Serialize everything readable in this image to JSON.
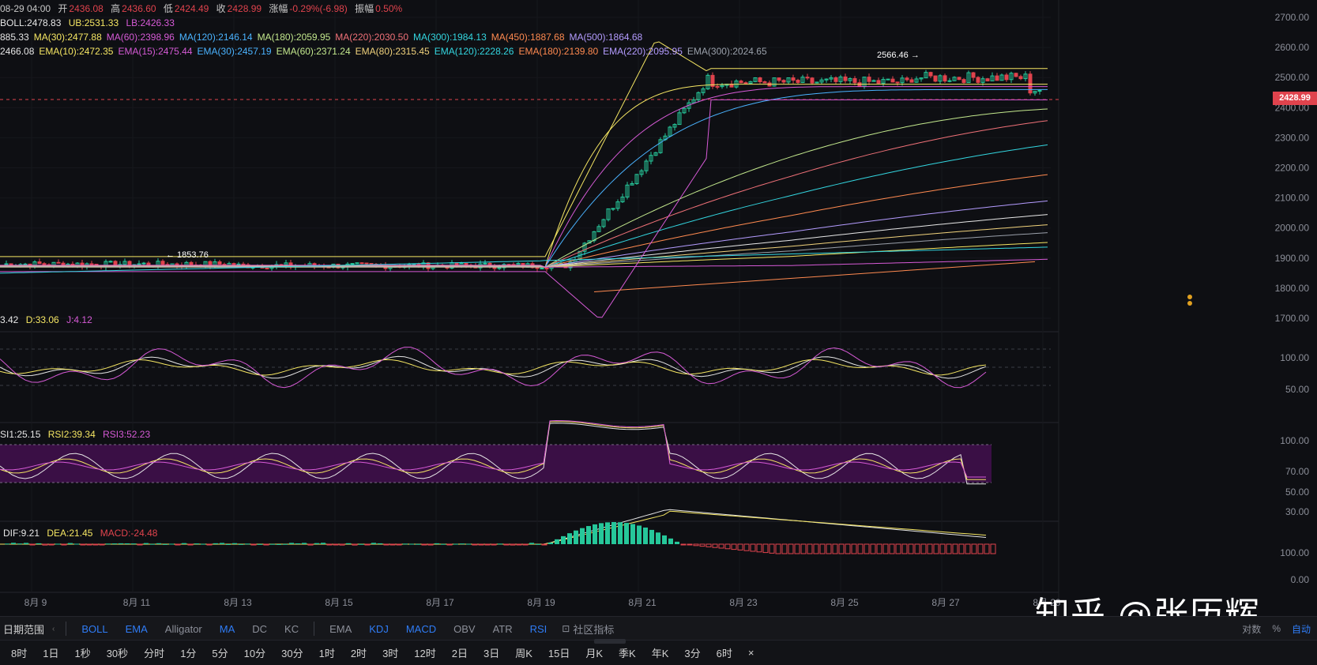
{
  "header": {
    "row1": {
      "time": "08-29 04:00",
      "open_label": "开",
      "open": "2436.08",
      "high_label": "高",
      "high": "2436.60",
      "low_label": "低",
      "low": "2424.49",
      "close_label": "收",
      "close": "2428.99",
      "chg_label": "涨幅",
      "chg": "-0.29%(-6.98)",
      "amp_label": "振幅",
      "amp": "0.50%"
    },
    "row2": {
      "boll": "BOLL:2478.83",
      "ub": "UB:2531.33",
      "lb": "LB:2426.33"
    },
    "row3": [
      "885.33",
      "MA(30):2477.88",
      "MA(60):2398.96",
      "MA(120):2146.14",
      "MA(180):2059.95",
      "MA(220):2030.50",
      "MA(300):1984.13",
      "MA(450):1887.68",
      "MA(500):1864.68"
    ],
    "row4": [
      "2466.08",
      "EMA(10):2472.35",
      "EMA(15):2475.44",
      "EMA(30):2457.19",
      "EMA(60):2371.24",
      "EMA(80):2315.45",
      "EMA(120):2228.26",
      "EMA(180):2139.80",
      "EMA(220):2095.95",
      "EMA(300):2024.65"
    ],
    "kdj": [
      "3.42",
      "D:33.06",
      "J:4.12"
    ],
    "rsi": [
      "SI1:25.15",
      "RSI2:39.34",
      "RSI3:52.23"
    ],
    "macd": [
      "DIF:9.21",
      "DEA:21.45",
      "MACD:-24.48"
    ]
  },
  "price_axis": [
    "2700.00",
    "2600.00",
    "2500.00",
    "2400.00",
    "2300.00",
    "2200.00",
    "2100.00",
    "2000.00",
    "1900.00",
    "1800.00",
    "1700.00"
  ],
  "kdj_axis": [
    "100.00",
    "50.00"
  ],
  "rsi_axis": [
    "100.00",
    "70.00",
    "50.00",
    "30.00"
  ],
  "macd_axis": [
    "100.00",
    "0.00"
  ],
  "current_price": "2428.99",
  "high_marker": "2566.46",
  "low_marker": "1853.76",
  "date_axis": [
    "8月 9",
    "8月 11",
    "8月 13",
    "8月 15",
    "8月 17",
    "8月 19",
    "8月 21",
    "8月 23",
    "8月 25",
    "8月 27",
    "8月 29"
  ],
  "watermark": "知乎 @张历辉",
  "indicator_bar": {
    "range_label": "日期范围",
    "main": [
      "BOLL",
      "EMA",
      "Alligator",
      "MA",
      "DC",
      "KC"
    ],
    "main_active": [
      true,
      true,
      false,
      true,
      false,
      false
    ],
    "sub": [
      "EMA",
      "KDJ",
      "MACD",
      "OBV",
      "ATR",
      "RSI"
    ],
    "sub_active": [
      false,
      true,
      true,
      false,
      false,
      true
    ],
    "community": "社区指标",
    "right": [
      "对数",
      "%",
      "自动"
    ]
  },
  "timeframes": [
    "8时",
    "1日",
    "1秒",
    "30秒",
    "分时",
    "1分",
    "5分",
    "10分",
    "30分",
    "1时",
    "2时",
    "3时",
    "12时",
    "2日",
    "3日",
    "周K",
    "15日",
    "月K",
    "季K",
    "年K",
    "3分",
    "6时",
    "×"
  ],
  "colors": {
    "up": "#26c79a",
    "down": "#e0434d",
    "bg": "#0e0f13"
  }
}
